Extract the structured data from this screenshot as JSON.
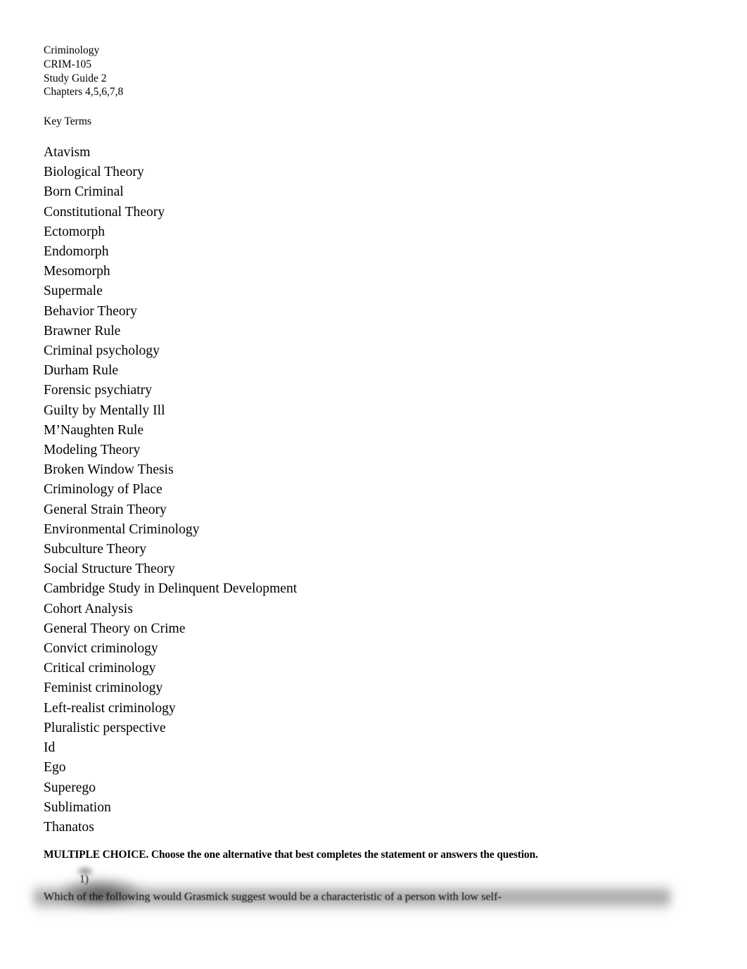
{
  "document": {
    "header_lines": [
      "Criminology",
      "CRIM-105",
      "Study Guide 2",
      "Chapters 4,5,6,7,8"
    ],
    "section_label": "Key Terms",
    "key_terms": [
      "Atavism",
      "Biological Theory",
      "Born Criminal",
      "Constitutional Theory",
      "Ectomorph",
      "Endomorph",
      "Mesomorph",
      "Supermale",
      "Behavior Theory",
      "Brawner Rule",
      "Criminal psychology",
      "Durham Rule",
      "Forensic psychiatry",
      "Guilty by Mentally Ill",
      "M’Naughten Rule",
      "Modeling Theory",
      "Broken Window Thesis",
      "Criminology of Place",
      "General Strain Theory",
      "Environmental Criminology",
      "Subculture Theory",
      "Social Structure Theory",
      "Cambridge Study in Delinquent Development",
      "Cohort Analysis",
      "General Theory on Crime",
      "Convict criminology",
      "Critical criminology",
      "Feminist criminology",
      "Left-realist criminology",
      "Pluralistic perspective",
      "Id",
      "Ego",
      "Superego",
      "Sublimation",
      "Thanatos"
    ],
    "instruction": "MULTIPLE CHOICE.  Choose the one alternative that best completes the statement or answers the question.",
    "question": {
      "number": "1)",
      "text": "Which of the following would Grasmick suggest would be a characteristic of a person with low self-"
    }
  },
  "colors": {
    "page_background": "#ffffff",
    "text": "#000000",
    "smudge": "#555555"
  }
}
